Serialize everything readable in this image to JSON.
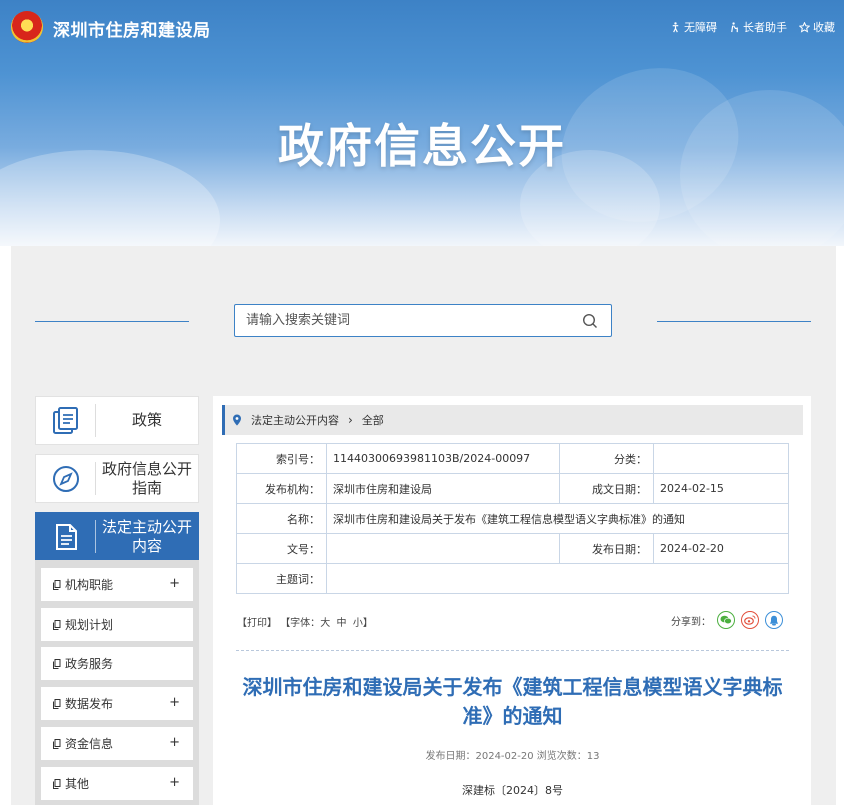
{
  "header": {
    "site_title": "深圳市住房和建设局",
    "links": [
      {
        "label": "无障碍",
        "icon": "accessibility-icon"
      },
      {
        "label": "长者助手",
        "icon": "elder-assistant-icon"
      },
      {
        "label": "收藏",
        "icon": "star-icon"
      }
    ],
    "banner_title": "政府信息公开"
  },
  "search": {
    "placeholder": "请输入搜索关键词",
    "icon": "search-icon"
  },
  "nav": {
    "main": [
      {
        "label": "政策",
        "icon": "document-stack-icon",
        "active": false
      },
      {
        "label": "政府信息公开指南",
        "icon": "compass-icon",
        "active": false
      },
      {
        "label": "法定主动公开内容",
        "icon": "document-icon",
        "active": true
      }
    ],
    "sub": [
      {
        "label": "机构职能",
        "expandable": true,
        "plus": "+"
      },
      {
        "label": "规划计划",
        "expandable": false
      },
      {
        "label": "政务服务",
        "expandable": false
      },
      {
        "label": "数据发布",
        "expandable": true,
        "plus": "+"
      },
      {
        "label": "资金信息",
        "expandable": true,
        "plus": "+"
      },
      {
        "label": "其他",
        "expandable": true,
        "plus": "+"
      }
    ]
  },
  "breadcrumb": {
    "items": [
      "法定主动公开内容",
      "全部"
    ],
    "separator": "›"
  },
  "meta": {
    "index_label": "索引号：",
    "index_value": "11440300693981103B/2024-00097",
    "category_label": "分类：",
    "category_value": "",
    "agency_label": "发布机构：",
    "agency_value": "深圳市住房和建设局",
    "created_label": "成文日期：",
    "created_value": "2024-02-15",
    "name_label": "名称：",
    "name_value": "深圳市住房和建设局关于发布《建筑工程信息模型语义字典标准》的通知",
    "docno_label": "文号：",
    "docno_value": "",
    "published_label": "发布日期：",
    "published_value": "2024-02-20",
    "subject_label": "主题词：",
    "subject_value": ""
  },
  "tools": {
    "print": "【打印】",
    "font_prefix": "【字体：",
    "font_large": "大",
    "font_medium": "中",
    "font_small": "小",
    "font_suffix": "】"
  },
  "share": {
    "label": "分享到：",
    "targets": [
      {
        "icon": "wechat-icon",
        "color": "#4caf3f"
      },
      {
        "icon": "weibo-icon",
        "color": "#e2503c"
      },
      {
        "icon": "qq-icon",
        "color": "#3c8fd8"
      }
    ]
  },
  "article": {
    "title": "深圳市住房和建设局关于发布《建筑工程信息模型语义字典标准》的通知",
    "pub_info": "发布日期：2024-02-20  浏览次数：13",
    "doc_number": "深建标〔2024〕8号"
  },
  "colors": {
    "accent": "#2f6db5",
    "banner": "#3d82c6",
    "panel": "#efefef"
  }
}
